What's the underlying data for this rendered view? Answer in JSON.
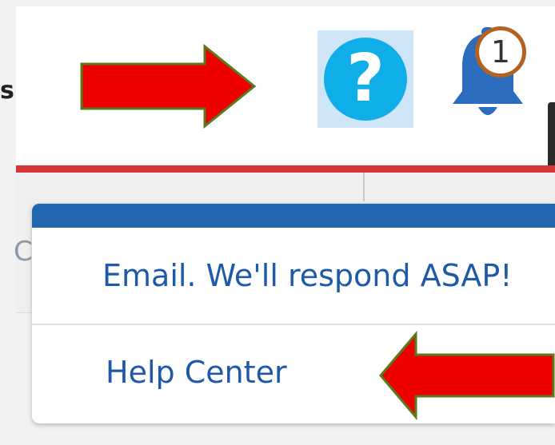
{
  "header": {
    "left_fragment": "s",
    "help_icon_glyph": "?",
    "notification_count": "1"
  },
  "subnav": {
    "left_fragment": "C"
  },
  "help_menu": {
    "items": [
      {
        "label": "Email. We'll respond ASAP!",
        "icon": "none"
      },
      {
        "label": "Help Center",
        "icon": "none"
      }
    ]
  },
  "annotations": {
    "arrow_color": "#ee0000",
    "arrow_outline": "#5a7a1e"
  },
  "colors": {
    "accent_red_line": "#d7373b",
    "menu_header": "#2266b0",
    "help_icon": "#10aee8",
    "help_highlight": "#cfe5f8",
    "bell": "#2b6cbf",
    "badge_border": "#b46221",
    "link_text": "#1e5aa8"
  }
}
